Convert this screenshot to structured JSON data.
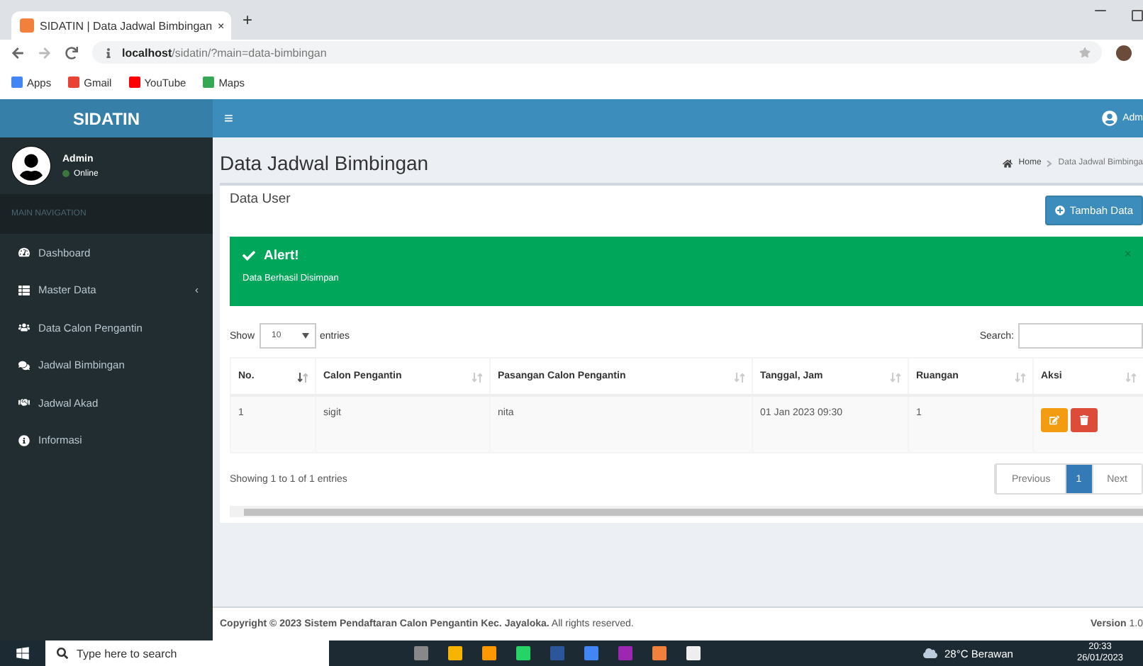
{
  "browser": {
    "tab_title": "SIDATIN | Data Jadwal Bimbingan",
    "tab_close": "×",
    "new_tab": "+",
    "url_host": "localhost",
    "url_path": "/sidatin/?main=data-bimbingan",
    "bookmarks": [
      "Apps",
      "Gmail",
      "YouTube",
      "Maps"
    ]
  },
  "header": {
    "logo": "SIDATIN",
    "menu_glyph": "≡",
    "user": "Adm"
  },
  "user_panel": {
    "name": "Admin",
    "status": "Online"
  },
  "nav": {
    "heading": "MAIN NAVIGATION",
    "items": [
      {
        "label": "Dashboard",
        "selected": false
      },
      {
        "label": "Master Data",
        "caret": "‹",
        "selected": false
      },
      {
        "label": "Data Calon Pengantin",
        "selected": false
      },
      {
        "label": "Jadwal Bimbingan",
        "selected": false
      },
      {
        "label": "Jadwal Akad",
        "selected": false
      },
      {
        "label": "Informasi",
        "selected": false
      }
    ]
  },
  "page": {
    "title": "Data Jadwal Bimbingan",
    "breadcrumb": [
      "Home",
      "Data Jadwal Bimbinga"
    ]
  },
  "box": {
    "title": "Data User",
    "add_button": "Tambah Data",
    "alert": {
      "title": "Alert!",
      "message": "Data Berhasil Disimpan",
      "close": "×"
    },
    "length": {
      "show": "Show",
      "value": "10",
      "suffix": "entries"
    },
    "search": {
      "label": "Search:"
    },
    "table": {
      "columns": [
        {
          "label": "No.",
          "sorted": true
        },
        {
          "label": "Calon Pengantin",
          "sorted": false
        },
        {
          "label": "Pasangan Calon Pengantin",
          "sorted": false
        },
        {
          "label": "Tanggal, Jam",
          "sorted": false
        },
        {
          "label": "Ruangan",
          "sorted": false
        },
        {
          "label": "Aksi",
          "sorted": false
        }
      ],
      "rows": [
        {
          "cells": [
            "1",
            "sigit",
            "nita",
            "01 Jan 2023 09:30",
            "1"
          ]
        }
      ]
    },
    "info": "Showing 1 to 1 of 1 entries",
    "pagination": [
      {
        "label": "Previous",
        "selected": false
      },
      {
        "label": "1",
        "selected": true
      },
      {
        "label": "Next",
        "selected": false
      }
    ]
  },
  "footer": {
    "copyright": "**Copyright © 2023 Sistem Pendaftaran Calon Pengantin Kec. Jayaloka.** All rights reserved.",
    "version": "**Version** 1.0"
  },
  "taskbar": {
    "search_placeholder": "Type here to search",
    "weather": "28°C  Berawan",
    "time": "20:33",
    "date": "26/01/2023"
  }
}
